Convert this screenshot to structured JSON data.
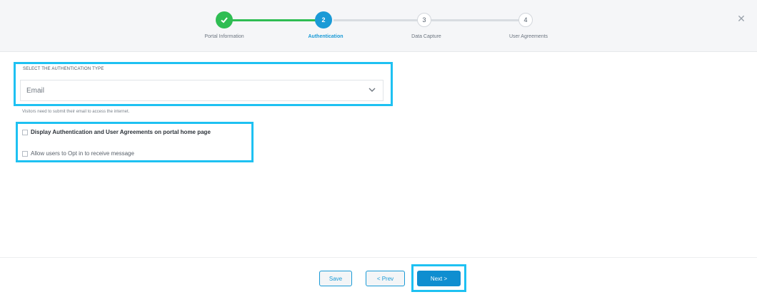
{
  "wizard": {
    "steps": [
      {
        "number": "1",
        "label": "Portal Information",
        "state": "complete"
      },
      {
        "number": "2",
        "label": "Authentication",
        "state": "active"
      },
      {
        "number": "3",
        "label": "Data Capture",
        "state": "pending"
      },
      {
        "number": "4",
        "label": "User Agreements",
        "state": "pending"
      }
    ],
    "close_icon": "close-icon"
  },
  "auth": {
    "label": "SELECT THE AUTHENTICATION TYPE",
    "selected": "Email",
    "hint": "Visitors need to submit their email to access the internet."
  },
  "options": {
    "display_auth": "Display Authentication and User Agreements on portal home page",
    "opt_in": "Allow users to Opt in to receive message"
  },
  "footer": {
    "save": "Save",
    "prev": "< Prev",
    "next": "Next >"
  },
  "colors": {
    "complete": "#2fbd53",
    "active": "#1a9ad6",
    "highlight": "#1ec1f2"
  }
}
